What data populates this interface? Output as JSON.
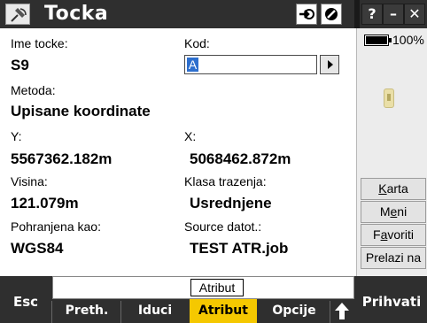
{
  "window": {
    "title": "Tocka",
    "buttons": {
      "help": "?",
      "minimize": "–",
      "close": "✕"
    }
  },
  "status": {
    "battery_level": 100,
    "battery_label": "100%"
  },
  "fields": {
    "ime_tocke": {
      "label": "Ime tocke:",
      "value": "S9"
    },
    "kod": {
      "label": "Kod:",
      "value": "A"
    },
    "metoda": {
      "label": "Metoda:",
      "value": "Upisane koordinate"
    },
    "y": {
      "label": "Y:",
      "value": "5567362.182m"
    },
    "x": {
      "label": "X:",
      "value": "5068462.872m"
    },
    "visina": {
      "label": "Visina:",
      "value": "121.079m"
    },
    "klasa_trazenja": {
      "label": "Klasa trazenja:",
      "value": "Usrednjene"
    },
    "pohranjena_kao": {
      "label": "Pohranjena kao:",
      "value": "WGS84"
    },
    "source_datot": {
      "label": "Source datot.:",
      "value": "TEST ATR.job"
    }
  },
  "side_buttons": [
    {
      "label": "Karta"
    },
    {
      "label": "Meni"
    },
    {
      "label": "Favoriti"
    },
    {
      "label": "Prelazi na"
    }
  ],
  "status_field": {
    "text": "Atribut"
  },
  "softkeys": {
    "esc": "Esc",
    "prethodni": "Preth.",
    "iduci": "Iduci",
    "atribut": "Atribut",
    "opcije": "Opcije",
    "prihvati": "Prihvati"
  },
  "colors": {
    "bar_background": "#2f2f2f",
    "active_softkey": "#f5c800",
    "selection": "#2d6fce"
  }
}
